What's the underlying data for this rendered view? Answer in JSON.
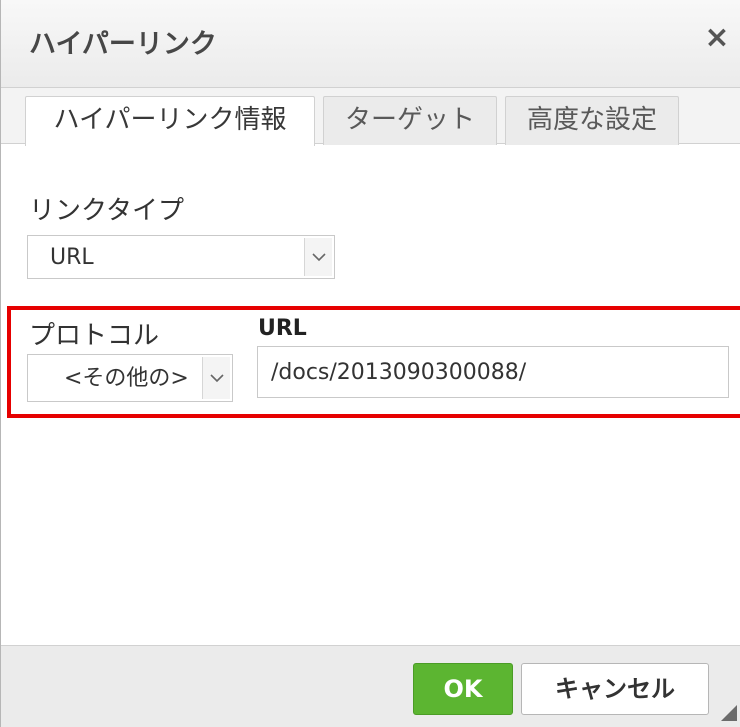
{
  "dialog": {
    "title": "ハイパーリンク",
    "close_label": "×"
  },
  "tabs": [
    {
      "label": "ハイパーリンク情報",
      "active": true
    },
    {
      "label": "ターゲット",
      "active": false
    },
    {
      "label": "高度な設定",
      "active": false
    }
  ],
  "form": {
    "link_type": {
      "label": "リンクタイプ",
      "value": "URL"
    },
    "protocol": {
      "label": "プロトコル",
      "value": "<その他の>"
    },
    "url": {
      "label": "URL",
      "value": "/docs/2013090300088/"
    }
  },
  "footer": {
    "ok_label": "OK",
    "cancel_label": "キャンセル"
  },
  "colors": {
    "ok_button": "#5cb531",
    "highlight_box": "#e60000"
  },
  "icons": {
    "close": "close-icon",
    "dropdown": "chevron-down-icon",
    "resize": "resize-grip-icon"
  }
}
